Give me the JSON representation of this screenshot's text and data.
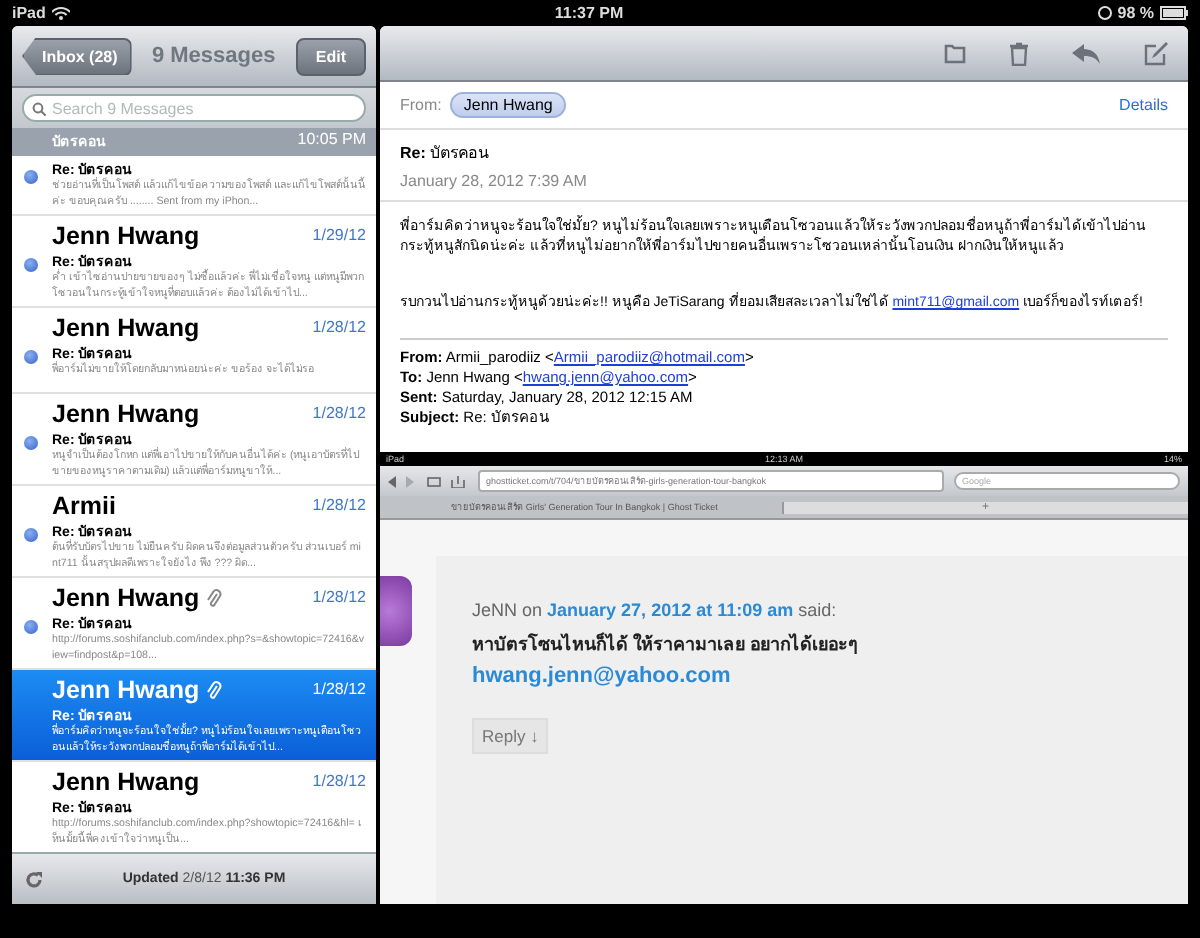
{
  "status_bar": {
    "device": "iPad",
    "time": "11:37 PM",
    "battery": "98 %"
  },
  "mailbox": {
    "back_button": "Inbox (28)",
    "title": "9 Messages",
    "edit_button": "Edit",
    "search": {
      "placeholder": "Search 9 Messages"
    },
    "messages": [
      {
        "kind": "partial",
        "label": "บัตรคอน",
        "date": "10:05 PM",
        "subject": "Re: บัตรคอน",
        "preview": "ช่วยอ่านที่เป็นโพสต์ แล้วแก้ไขข้อความของโพสต์ และแก้ไขโพสต์นั้นนี้ค่ะ ขอบคุณครับ ........ Sent from my iPhon...",
        "unread": true,
        "attachment": false,
        "selected": false
      },
      {
        "kind": "full",
        "sender": "Jenn Hwang",
        "date": "1/29/12",
        "subject": "Re: บัตรคอน",
        "preview": "ค่ำ เข้าไซอ่านปายขายของๆ ไม่ซื้อแล้วค่ะ พี่ไม่เชื่อใจหนู แต่หนูมีพวกโซวอนในกระทู้เข้าใจหนูที่ตอบแล้วค่ะ ต้องไม่ได้เข้าไป...",
        "unread": true,
        "attachment": false,
        "selected": false
      },
      {
        "kind": "full",
        "sender": "Jenn Hwang",
        "date": "1/28/12",
        "subject": "Re: บัตรคอน",
        "preview": "พี่อาร์มไม่ขายให้โดยกลับมาหน่อยน่ะค่ะ ขอร้อง จะได้ไม่รอ",
        "unread": true,
        "attachment": false,
        "selected": false
      },
      {
        "kind": "full",
        "sender": "Jenn Hwang",
        "date": "1/28/12",
        "subject": "Re: บัตรคอน",
        "preview": "หนูจำเป็นต้องโกหก แต่พี่เอาไปขายให้กับคนอื่นได้ค่ะ (หนูเอาบัตรที่ไปขายของหนูราคาตามเดิม) แล้วแต่พี่อาร์มหนูขาให้...",
        "unread": true,
        "attachment": false,
        "selected": false
      },
      {
        "kind": "full",
        "sender": "Armii",
        "date": "1/28/12",
        "subject": "Re: บัตรคอน",
        "preview": "ต้นที่รับบัตรไปขาย ไม่ยืนครับ ผิดคนจึงต่อมูลส่วนตัวครับ ส่วนเบอร์ mint711 นั้นสรุปผลดีเพราะใจยังไง พึง ??? ผิด...",
        "unread": true,
        "attachment": false,
        "selected": false
      },
      {
        "kind": "full",
        "sender": "Jenn Hwang",
        "date": "1/28/12",
        "subject": "Re: บัตรคอน",
        "preview": "http://forums.soshifanclub.com/index.php?s=&showtopic=72416&view=findpost&p=108...",
        "unread": true,
        "attachment": true,
        "selected": false
      },
      {
        "kind": "full",
        "sender": "Jenn Hwang",
        "date": "1/28/12",
        "subject": "Re: บัตรคอน",
        "preview": "พี่อาร์มคิดว่าหนูจะร้อนใจใช่มั้ย? หนูไม่ร้อนใจเลยเพราะหนูเตือนโซวอนแล้วให้ระวังพวกปลอมชื่อหนูถ้าพี่อาร์มได้เข้าไป...",
        "unread": false,
        "attachment": true,
        "selected": true
      },
      {
        "kind": "full",
        "sender": "Jenn Hwang",
        "date": "1/28/12",
        "subject": "Re: บัตรคอน",
        "preview": "http://forums.soshifanclub.com/index.php?showtopic=72416&hl= เห็นมั้ยนี้พี่คงเข้าใจว่าหนูเป็น...",
        "unread": false,
        "attachment": false,
        "selected": false
      }
    ],
    "footer": "**Updated** 2/8/12 **11:36 PM**"
  },
  "message": {
    "from_label": "From:",
    "from": "Jenn Hwang",
    "details": "Details",
    "subject": "**Re:** บัตรคอน",
    "date": "January 28, 2012 7:39 AM",
    "paragraphs": [
      {
        "before": "พี่อาร์มคิดว่าหนูจะร้อนใจใช่มั้ย? หนูไม่ร้อนใจเลยเพราะหนูเตือนโซวอนแล้วให้ระวังพวกปลอมชื่อหนูถ้าพี่อาร์มได้เข้าไปอ่านกระทู้หนูสักนิดน่ะค่ะ แล้วที่หนูไม่อยากให้พี่อาร์มไปขายคนอื่นเพราะโซวอนเหล่านั้นโอนเงิน ฝากเงินให้หนูแล้ว"
      },
      {
        "before": "รบกวนไปอ่านกระทู้หนูด้วยน่ะค่ะ!! หนูคือ JeTiSarang ที่ยอมเสียสละเวลาไม่ใช่ได้ ",
        "link": "mint711@gmail.com",
        "after": " เบอร์ก็ของไรท์เตอร์!"
      }
    ],
    "forward_header": [
      {
        "label": "From:",
        "prefix": " Armii_parodiiz <",
        "email": "Armii_parodiiz@hotmail.com",
        "suffix": ">"
      },
      {
        "label": "To:",
        "prefix": " Jenn Hwang <",
        "email": "hwang.jenn@yahoo.com",
        "suffix": ">"
      },
      {
        "label": "Sent:",
        "prefix": " Saturday, January 28, 2012 12:15 AM"
      },
      {
        "label": "Subject:",
        "prefix": " Re: บัตรคอน"
      }
    ],
    "attached_screenshot": {
      "device": "iPad",
      "time": "12:13 AM",
      "battery": "14%",
      "url": "ghostticket.com/t/704/ขายบัตรคอนเสิร์ต-girls-generation-tour-bangkok",
      "search_placeholder": "Google",
      "new_tab_button": "+",
      "tab_title": "ขายบัตรคอนเสิร์ต Girls' Generation Tour In Bangkok | Ghost Ticket",
      "comment": {
        "author": "JeNN on ",
        "date_link": "January 27, 2012 at 11:09 am",
        "said": " said:",
        "text": "หาบัตรโซนไหนก็ได้ ให้ราคามาเลย อยากได้เยอะๆ",
        "email": "hwang.jenn@yahoo.com",
        "reply": "Reply ↓"
      }
    }
  }
}
